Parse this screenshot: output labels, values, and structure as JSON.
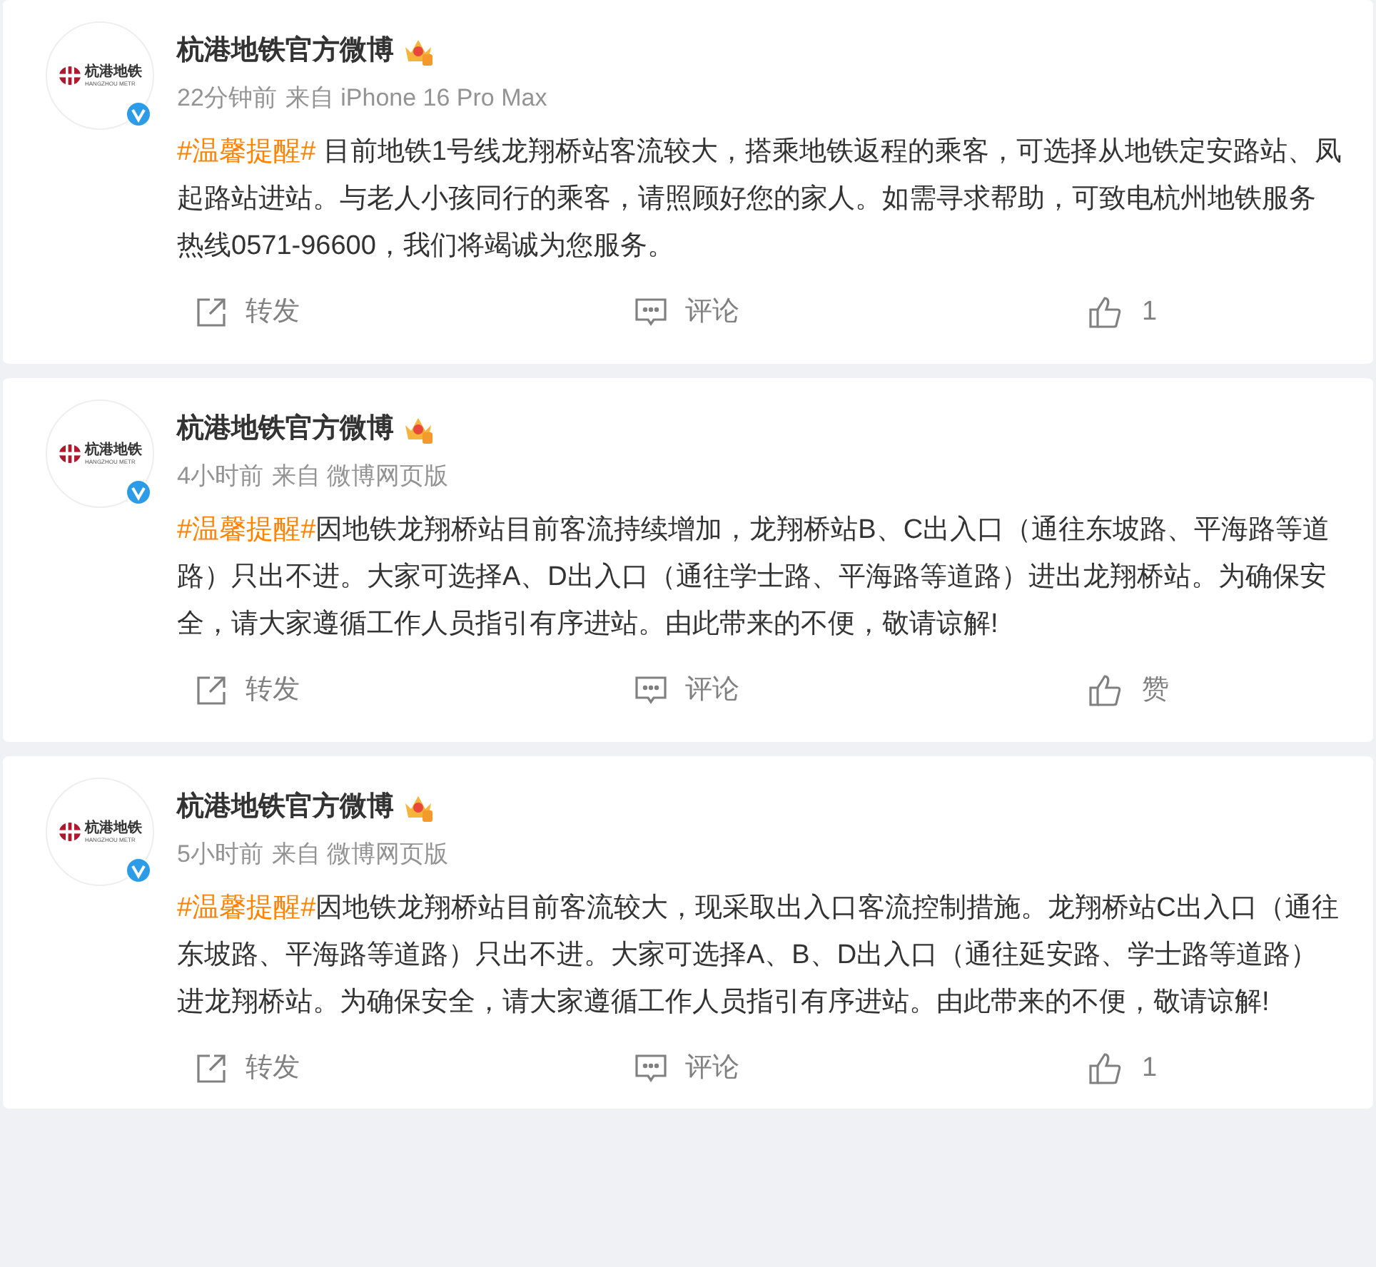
{
  "posts": [
    {
      "avatar": {
        "logo_name": "杭港地铁",
        "logo_subtitle": "HANGZHOU METR",
        "verified": true
      },
      "author": "杭港地铁官方微博",
      "time": "22分钟前",
      "source": "来自 iPhone 16 Pro Max",
      "hashtag": "#温馨提醒#",
      "text": " 目前地铁1号线龙翔桥站客流较大，搭乘地铁返程的乘客，可选择从地铁定安路站、凤起路站进站。与老人小孩同行的乘客，请照顾好您的家人。如需寻求帮助，可致电杭州地铁服务热线0571-96600，我们将竭诚为您服务。",
      "actions": {
        "repost": "转发",
        "comment": "评论",
        "like": "1"
      }
    },
    {
      "avatar": {
        "logo_name": "杭港地铁",
        "logo_subtitle": "HANGZHOU METR",
        "verified": true
      },
      "author": "杭港地铁官方微博",
      "time": "4小时前",
      "source": "来自 微博网页版",
      "hashtag": "#温馨提醒#",
      "text": "因地铁龙翔桥站目前客流持续增加，龙翔桥站B、C出入口（通往东坡路、平海路等道路）只出不进。大家可选择A、D出入口（通往学士路、平海路等道路）进出龙翔桥站。为确保安全，请大家遵循工作人员指引有序进站。由此带来的不便，敬请谅解!",
      "actions": {
        "repost": "转发",
        "comment": "评论",
        "like": "赞"
      }
    },
    {
      "avatar": {
        "logo_name": "杭港地铁",
        "logo_subtitle": "HANGZHOU METR",
        "verified": true
      },
      "author": "杭港地铁官方微博",
      "time": "5小时前",
      "source": "来自 微博网页版",
      "hashtag": "#温馨提醒#",
      "text": "因地铁龙翔桥站目前客流较大，现采取出入口客流控制措施。龙翔桥站C出入口（通往东坡路、平海路等道路）只出不进。大家可选择A、B、D出入口（通往延安路、学士路等道路）进龙翔桥站。为确保安全，请大家遵循工作人员指引有序进站。由此带来的不便，敬请谅解!",
      "actions": {
        "repost": "转发",
        "comment": "评论",
        "like": "1"
      }
    }
  ]
}
